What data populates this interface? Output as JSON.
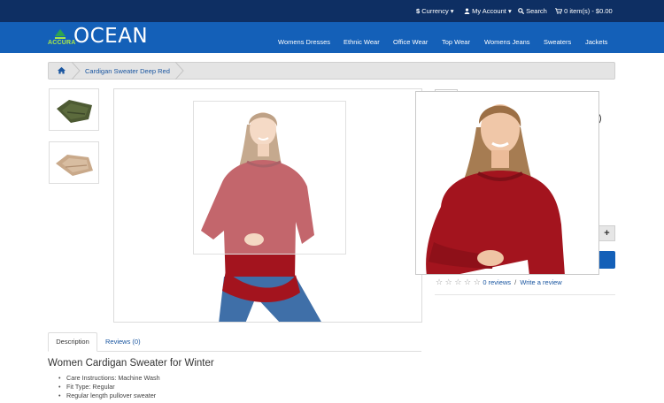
{
  "topbar": {
    "currency": "Currency",
    "account": "My Account",
    "search": "Search",
    "cart": "0 item(s) - $0.00"
  },
  "header": {
    "logo_small": "ACCURA",
    "logo_big": "OCEAN",
    "nav": [
      "Womens Dresses",
      "Ethnic Wear",
      "Office Wear",
      "Top Wear",
      "Womens Jeans",
      "Sweaters",
      "Jackets"
    ]
  },
  "breadcrumb": {
    "current": "Cardigan Sweater Deep Red"
  },
  "product": {
    "title_fragment": ")",
    "qty_plus": "+",
    "stars": [
      "☆",
      "☆",
      "☆",
      "☆",
      "☆"
    ],
    "reviews_link": "0 reviews",
    "separator": "/",
    "write_review": "Write a review"
  },
  "tabs": {
    "description": "Description",
    "reviews": "Reviews (0)"
  },
  "description": {
    "title": "Women Cardigan Sweater for Winter",
    "bullets": [
      "Care Instructions: Machine Wash",
      "Fit Type: Regular",
      "Regular length pullover sweater"
    ]
  },
  "colors": {
    "topbar": "#0e2f63",
    "header": "#1460b8",
    "accent_link": "#1a56a0",
    "sweater": "#a3141e"
  }
}
